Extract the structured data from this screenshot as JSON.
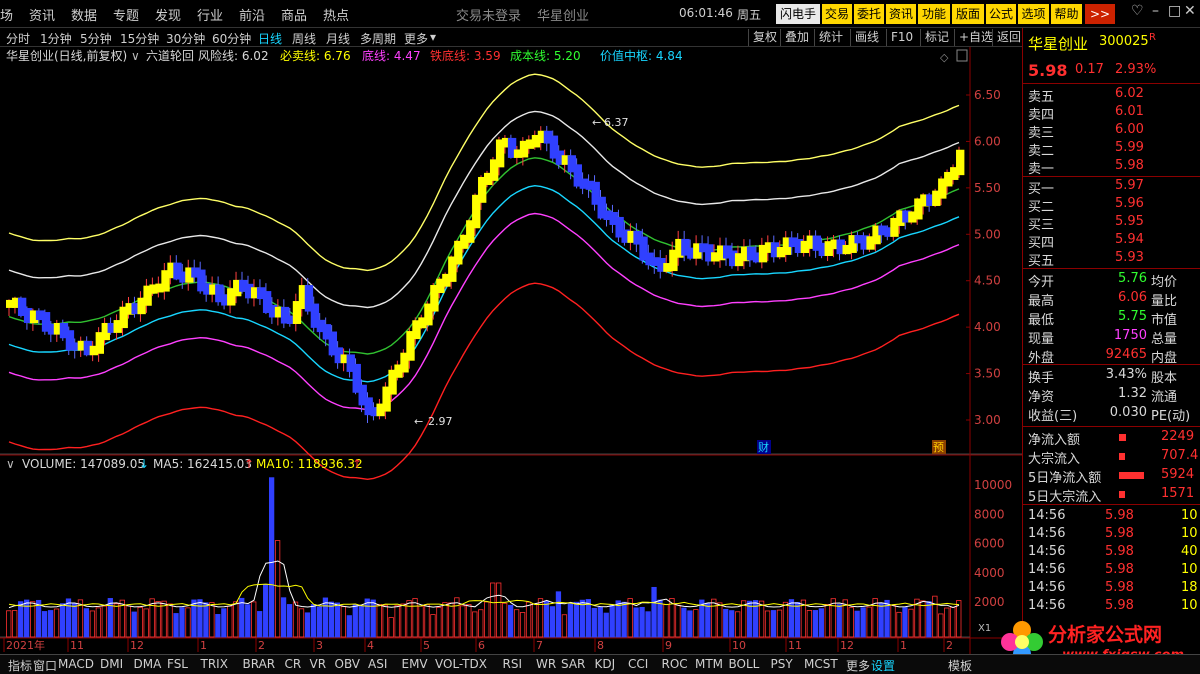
{
  "menu": {
    "items": [
      "场",
      "资讯",
      "数据",
      "专题",
      "发现",
      "行业",
      "前沿",
      "商品",
      "热点"
    ],
    "center_items": [
      "交易未登录",
      "华星创业"
    ],
    "time": "06:01:46",
    "weekday": "周五",
    "buttons": [
      "闪电手",
      "交易",
      "委托",
      "资讯",
      "功能",
      "版面",
      "公式",
      "选项",
      "帮助",
      ">>"
    ]
  },
  "period_bar": {
    "periods": [
      "分时",
      "1分钟",
      "5分钟",
      "15分钟",
      "30分钟",
      "60分钟",
      "日线",
      "周线",
      "月线",
      "多周期",
      "更多"
    ],
    "active": "日线",
    "tools": [
      "复权",
      "叠加",
      "统计",
      "画线",
      "F10",
      "标记",
      "+自选",
      "返回"
    ]
  },
  "chart_header": {
    "stock": "华星创业(日线,前复权)",
    "indicator": "六道轮回",
    "lines": [
      {
        "text": "风险线: 6.02",
        "color": "#d8d8d8"
      },
      {
        "text": "必卖线: 6.76",
        "color": "#ffff00"
      },
      {
        "text": "底线: 4.47",
        "color": "#ff40ff"
      },
      {
        "text": "铁底线: 3.59",
        "color": "#ff3030"
      },
      {
        "text": "成本线: 5.20",
        "color": "#30ff30"
      },
      {
        "text": "价值中枢: 4.84",
        "color": "#18d6ff"
      }
    ]
  },
  "price_axis": [
    "6.50",
    "6.00",
    "5.50",
    "5.00",
    "4.50",
    "4.00",
    "3.50",
    "3.00"
  ],
  "annotations": {
    "high": "6.37",
    "low": "2.97",
    "marker1": "财",
    "marker2": "预"
  },
  "volume_header": {
    "volume": "VOLUME: 147089.05",
    "ma5": "MA5: 162415.03",
    "ma10": "MA10: 118936.32"
  },
  "volume_axis": [
    "10000",
    "8000",
    "6000",
    "4000",
    "2000"
  ],
  "volume_unit": "X1",
  "date_axis": [
    "2021年",
    "11",
    "12",
    "1",
    "2",
    "3",
    "4",
    "5",
    "6",
    "7",
    "8",
    "9",
    "10",
    "11",
    "12",
    "1",
    "2"
  ],
  "stock": {
    "name": "华星创业",
    "code": "300025",
    "flag": "R",
    "price": "5.98",
    "change": "0.17",
    "pct": "2.93%"
  },
  "orderbook": {
    "asks": [
      {
        "label": "卖五",
        "price": "6.02"
      },
      {
        "label": "卖四",
        "price": "6.01"
      },
      {
        "label": "卖三",
        "price": "6.00"
      },
      {
        "label": "卖二",
        "price": "5.99"
      },
      {
        "label": "卖一",
        "price": "5.98"
      }
    ],
    "bids": [
      {
        "label": "买一",
        "price": "5.97"
      },
      {
        "label": "买二",
        "price": "5.96"
      },
      {
        "label": "买三",
        "price": "5.95"
      },
      {
        "label": "买四",
        "price": "5.94"
      },
      {
        "label": "买五",
        "price": "5.93"
      }
    ]
  },
  "quote": [
    {
      "l1": "今开",
      "v1": "5.76",
      "c1": "#30ff30",
      "l2": "均价"
    },
    {
      "l1": "最高",
      "v1": "6.06",
      "c1": "#ff3030",
      "l2": "量比"
    },
    {
      "l1": "最低",
      "v1": "5.75",
      "c1": "#30ff30",
      "l2": "市值"
    },
    {
      "l1": "现量",
      "v1": "1750",
      "c1": "#ff40ff",
      "l2": "总量"
    },
    {
      "l1": "外盘",
      "v1": "92465",
      "c1": "#ff3030",
      "l2": "内盘"
    }
  ],
  "quote2": [
    {
      "l1": "换手",
      "v1": "3.43%",
      "l2": "股本"
    },
    {
      "l1": "净资",
      "v1": "1.32",
      "l2": "流通"
    },
    {
      "l1": "收益(三)",
      "v1": "0.030",
      "l2": "PE(动)"
    }
  ],
  "flows": [
    {
      "label": "净流入额",
      "value": "2249"
    },
    {
      "label": "大宗流入",
      "value": "707.4"
    },
    {
      "label": "5日净流入额",
      "value": "5924"
    },
    {
      "label": "5日大宗流入",
      "value": "1571"
    }
  ],
  "ticks": [
    {
      "time": "14:56",
      "price": "5.98",
      "vol": "10"
    },
    {
      "time": "14:56",
      "price": "5.98",
      "vol": "10"
    },
    {
      "time": "14:56",
      "price": "5.98",
      "vol": "40"
    },
    {
      "time": "14:56",
      "price": "5.98",
      "vol": "10"
    },
    {
      "time": "14:56",
      "price": "5.98",
      "vol": "18"
    },
    {
      "time": "14:56",
      "price": "5.98",
      "vol": "10"
    }
  ],
  "bottom_tabs": [
    "指标",
    "窗口",
    "MACD",
    "DMI",
    "DMA",
    "FSL",
    "TRIX",
    "BRAR",
    "CR",
    "VR",
    "OBV",
    "ASI",
    "EMV",
    "VOL-TDX",
    "RSI",
    "WR",
    "SAR",
    "KDJ",
    "CCI",
    "ROC",
    "MTM",
    "BOLL",
    "PSY",
    "MCST",
    "更多",
    "设置",
    "模板"
  ],
  "logo": {
    "text": "分析家公式网",
    "url": "www.fxjgsw.com"
  }
}
